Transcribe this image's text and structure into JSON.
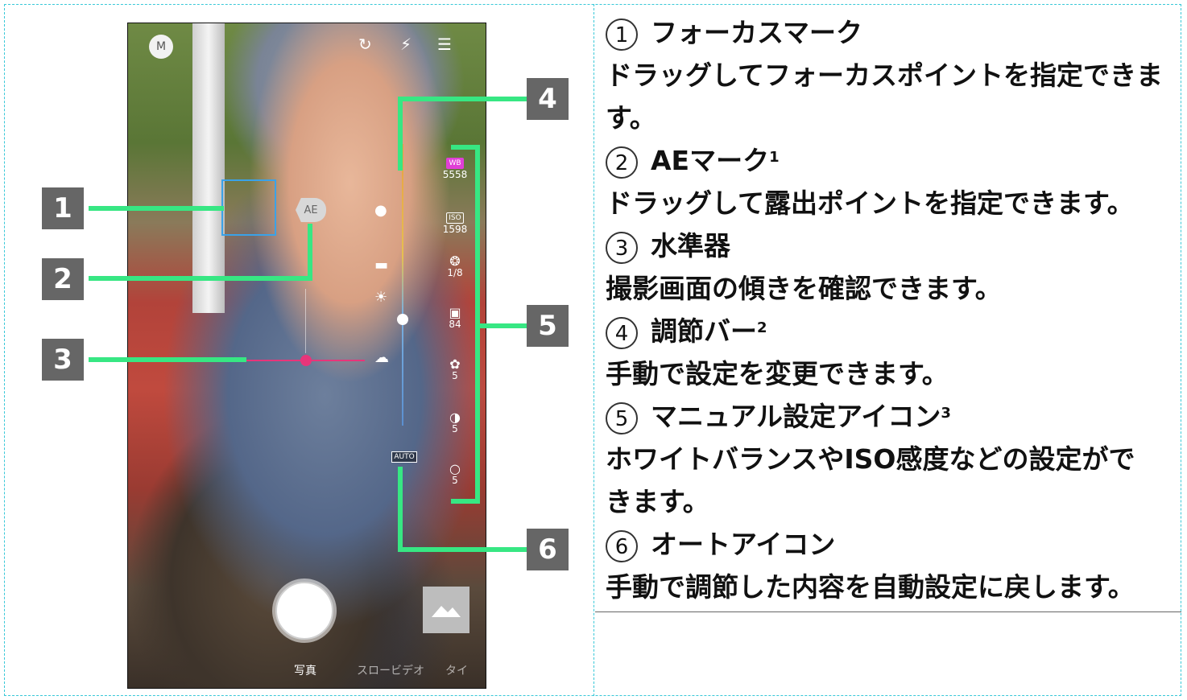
{
  "camera": {
    "mode_button": "M",
    "focus_mark_visible": true,
    "ae_mark_label": "AE",
    "side_settings": [
      {
        "icon": "white-balance",
        "value": "5558"
      },
      {
        "icon": "iso",
        "badge": "ISO",
        "value": "1598"
      },
      {
        "icon": "shutter-speed",
        "value": "1/8"
      },
      {
        "icon": "focus",
        "value": "84"
      },
      {
        "icon": "palette",
        "value": "5"
      },
      {
        "icon": "contrast",
        "value": "5"
      },
      {
        "icon": "sharpness",
        "value": "5"
      }
    ],
    "auto_button": "AUTO",
    "bottom_tabs": [
      "写真",
      "スロービデオ",
      "タイ"
    ],
    "accent_colors": {
      "callout": "#37e783",
      "level": "#e8357a",
      "focus": "#3aa2e8",
      "wb_badge": "#e03fd6"
    }
  },
  "callouts": [
    "1",
    "2",
    "3",
    "4",
    "5",
    "6"
  ],
  "descriptions": [
    {
      "mark": "①",
      "title": "フォーカスマーク",
      "note": "",
      "lines": [
        "ドラッグしてフォーカスポイントを指定できま",
        "す。"
      ]
    },
    {
      "mark": "②",
      "title": "AEマーク",
      "note": "1",
      "lines": [
        "ドラッグして露出ポイントを指定できます。"
      ]
    },
    {
      "mark": "③",
      "title": "水準器",
      "note": "",
      "lines": [
        "撮影画面の傾きを確認できます。"
      ]
    },
    {
      "mark": "④",
      "title": "調節バー",
      "note": "2",
      "lines": [
        "手動で設定を変更できます。"
      ]
    },
    {
      "mark": "⑤",
      "title": "マニュアル設定アイコン",
      "note": "3",
      "lines": [
        "ホワイトバランスやISO感度などの設定がで",
        "きます。"
      ]
    },
    {
      "mark": "⑥",
      "title": "オートアイコン",
      "note": "",
      "lines": [
        "手動で調節した内容を自動設定に戻します。"
      ]
    }
  ]
}
